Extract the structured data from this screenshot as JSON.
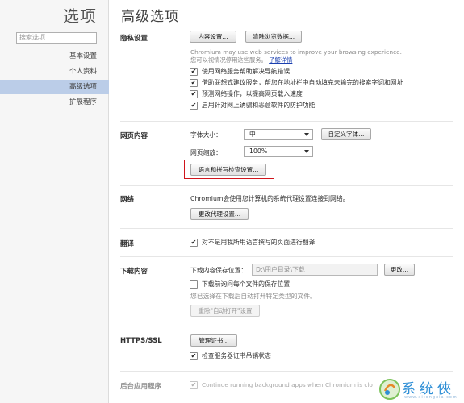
{
  "sidebar": {
    "title": "选项",
    "search_placeholder": "搜索选项",
    "items": [
      {
        "label": "基本设置"
      },
      {
        "label": "个人资料"
      },
      {
        "label": "高级选项"
      },
      {
        "label": "扩展程序"
      }
    ]
  },
  "main": {
    "title": "高级选项"
  },
  "privacy": {
    "label": "隐私设置",
    "content_settings_button": "内容设置...",
    "clear_data_button": "清除浏览数据...",
    "desc_line1": "Chromium may use web services to improve your browsing experience.",
    "desc_line2_prefix": "您可以视情况停用这些服务。",
    "learn_more": "了解详情",
    "options": [
      {
        "label": "使用网络服务帮助解决导航错误",
        "checked": true
      },
      {
        "label": "借助联想式建议服务，帮您在地址栏中自动填充未输完的搜索字词和网址",
        "checked": true
      },
      {
        "label": "预测网络操作，以提高网页载入速度",
        "checked": true
      },
      {
        "label": "启用针对网上诱骗和恶意软件的防护功能",
        "checked": true
      }
    ]
  },
  "webcontent": {
    "label": "网页内容",
    "font_size_label": "字体大小：",
    "font_size_value": "中",
    "custom_fonts_button": "自定义字体...",
    "zoom_label": "网页缩放：",
    "zoom_value": "100%",
    "language_button": "语言和拼写检查设置..."
  },
  "network": {
    "label": "网络",
    "desc": "Chromium会使用您计算机的系统代理设置连接到网络。",
    "proxy_button": "更改代理设置..."
  },
  "translate": {
    "label": "翻译",
    "option": {
      "label": "对不是用我所用语言撰写的页面进行翻译",
      "checked": true
    }
  },
  "downloads": {
    "label": "下载内容",
    "location_label": "下载内容保存位置：",
    "location_value": "D:\\用户目录\\下载",
    "change_button": "更改...",
    "ask_option": {
      "label": "下载前询问每个文件的保存位置",
      "checked": false
    },
    "auto_open_desc": "您已选择在下载后自动打开特定类型的文件。",
    "reset_button": "重除\"自动打开\"设置"
  },
  "https": {
    "label": "HTTPS/SSL",
    "certs_button": "管理证书...",
    "revocation_option": {
      "label": "检查服务器证书吊销状态",
      "checked": true
    }
  },
  "background": {
    "label": "后台应用程序",
    "option": {
      "label": "Continue running background apps when Chromium is clo",
      "checked": true
    }
  },
  "watermark": {
    "text": "系统俠",
    "url": "www.xitongxia.com"
  },
  "colors": {
    "nav_active": "#bbcde8",
    "highlight_border": "#d0141b",
    "link": "#1a3fb0"
  }
}
